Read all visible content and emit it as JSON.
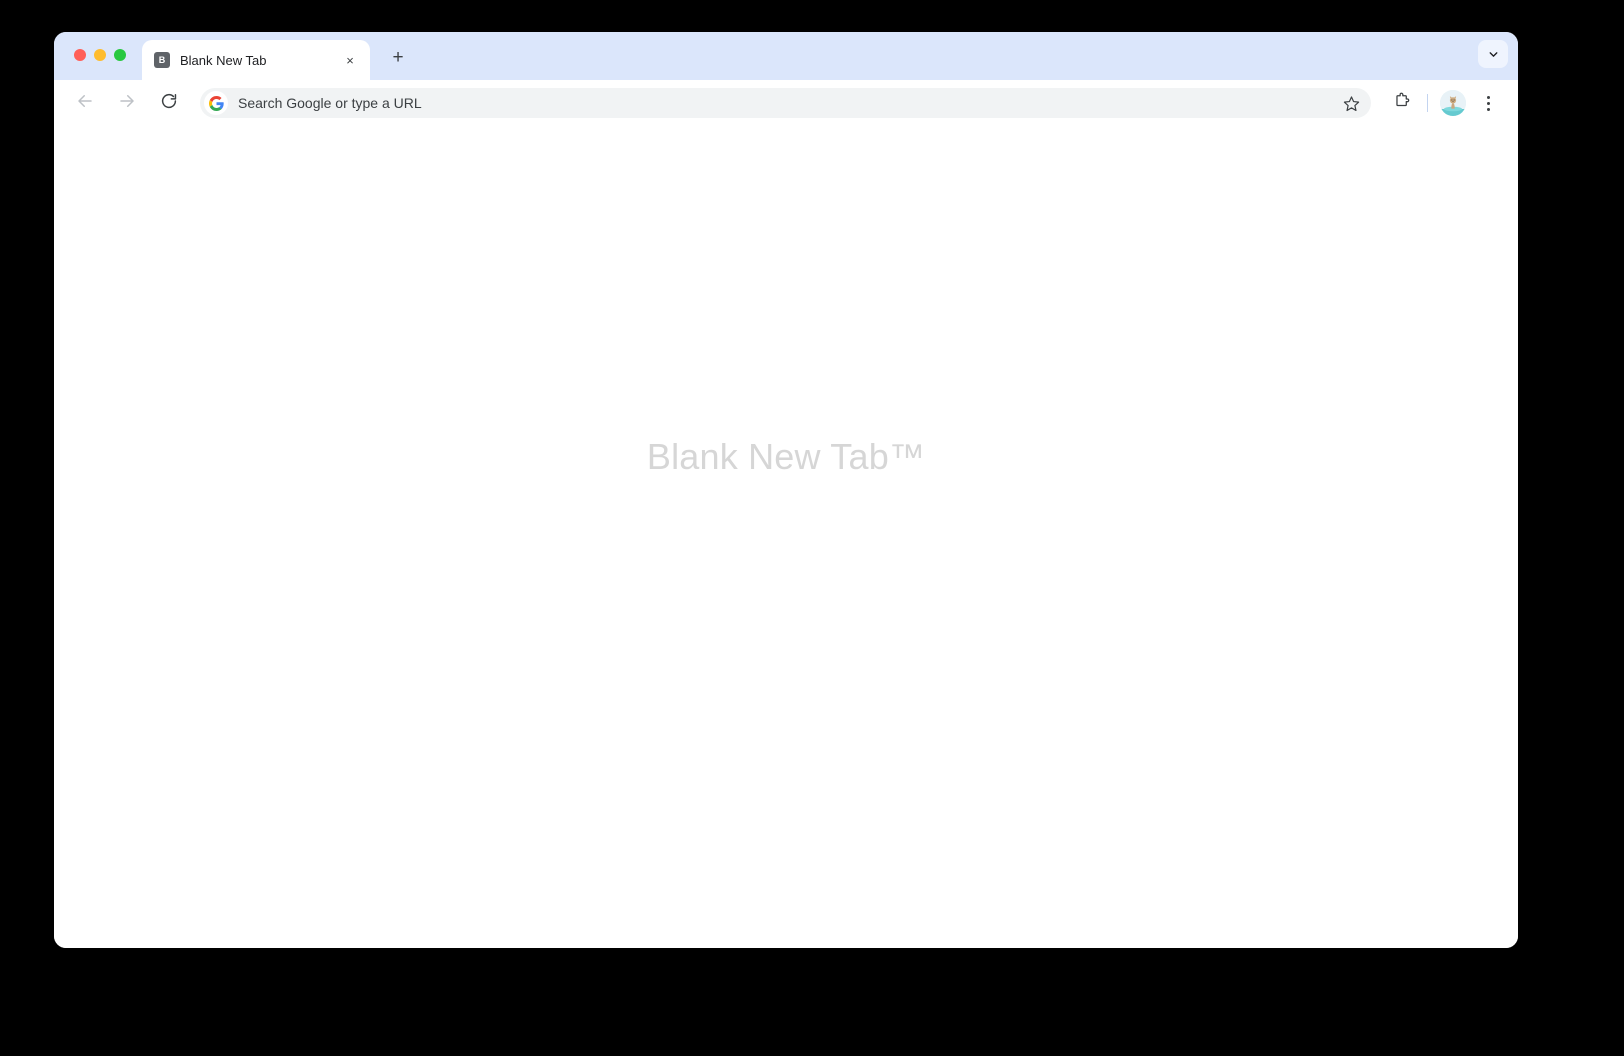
{
  "window": {
    "title": "Blank New Tab",
    "traffic_lights": [
      {
        "name": "close",
        "color": "#ff5f57"
      },
      {
        "name": "minimize",
        "color": "#febc2e"
      },
      {
        "name": "maximize",
        "color": "#28c840"
      }
    ],
    "tabstrip_bg": "#dbe6fb",
    "toolbar_bg": "#ffffff",
    "content_bg": "#ffffff"
  },
  "tabs": [
    {
      "title": "Blank New Tab",
      "favicon_letter": "B",
      "favicon_bg": "#5f6368",
      "active": true,
      "close_label": "×"
    }
  ],
  "tab_strip": {
    "new_tab_label": "+",
    "new_tab_icon": "plus-icon",
    "tab_search_icon": "chevron-down-icon"
  },
  "toolbar": {
    "back_icon": "arrow-left-icon",
    "forward_icon": "arrow-right-icon",
    "reload_icon": "reload-icon",
    "bookmark_icon": "star-outline-icon",
    "extensions_icon": "puzzle-piece-icon",
    "profile_icon": "avatar-icon",
    "menu_icon": "three-dot-menu-icon",
    "omnibox": {
      "value": "",
      "placeholder": "Search Google or type a URL",
      "display_text": "Search Google or type a URL",
      "leading_icon": "google-g-icon",
      "background": "#f1f3f4"
    }
  },
  "page": {
    "headline": "Blank New Tab™",
    "headline_color": "#d6d6d6"
  }
}
